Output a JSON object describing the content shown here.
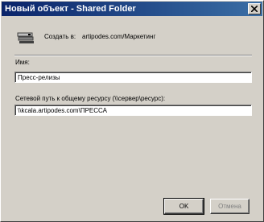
{
  "window": {
    "title": "Новый объект - Shared Folder"
  },
  "create": {
    "label": "Создать в:",
    "path": "artipodes.com/Маркетинг"
  },
  "name_field": {
    "label": "Имя:",
    "value": "Пресс-релизы"
  },
  "share_field": {
    "label": "Сетевой путь к общему ресурсу (\\\\сервер\\ресурс):",
    "value": "\\\\kcala.artipodes.com\\ПРЕССА"
  },
  "buttons": {
    "ok_label": "OK",
    "cancel_label": "Отмена"
  },
  "icons": {
    "close": "close-icon",
    "folder": "shared-folder-icon"
  },
  "colors": {
    "titlebar_start": "#0a246a",
    "titlebar_end": "#3a6ea5",
    "dialog_bg": "#d4d0c8"
  }
}
